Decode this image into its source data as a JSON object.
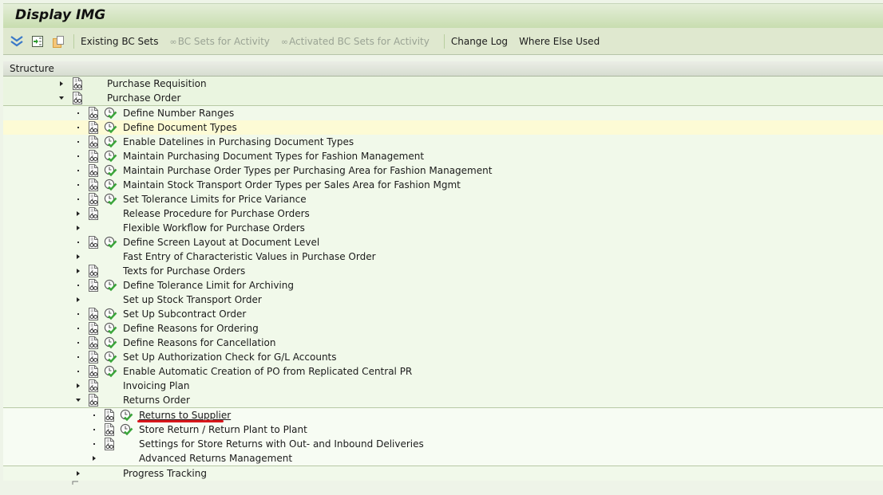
{
  "window": {
    "title": "Display IMG"
  },
  "toolbar": {
    "icons": [
      "expand-all-icon",
      "execute-icon",
      "clipboard-icon"
    ],
    "existing_bc_sets": "Existing BC Sets",
    "bc_sets_for_activity": "BC Sets for Activity",
    "activated_bc_sets_for_activity": "Activated BC Sets for Activity",
    "change_log": "Change Log",
    "where_else_used": "Where Else Used"
  },
  "structure": {
    "header": "Structure",
    "level1": [
      {
        "label": "Purchase Requisition",
        "expander": "collapsed",
        "doc_icon": true,
        "activity_icon": false
      },
      {
        "label": "Purchase Order",
        "expander": "expanded",
        "doc_icon": true,
        "activity_icon": false
      }
    ],
    "purchase_order_children": [
      {
        "label": "Define Number Ranges",
        "expander": "leaf",
        "doc_icon": true,
        "activity_icon": true
      },
      {
        "label": "Define Document Types",
        "expander": "leaf",
        "doc_icon": true,
        "activity_icon": true,
        "highlighted": true
      },
      {
        "label": "Enable Datelines in Purchasing Document Types",
        "expander": "leaf",
        "doc_icon": true,
        "activity_icon": true
      },
      {
        "label": "Maintain Purchasing Document Types for Fashion Management",
        "expander": "leaf",
        "doc_icon": true,
        "activity_icon": true
      },
      {
        "label": "Maintain Purchase Order Types per Purchasing Area for Fashion Management",
        "expander": "leaf",
        "doc_icon": true,
        "activity_icon": true
      },
      {
        "label": "Maintain Stock Transport Order Types per Sales Area for Fashion Mgmt",
        "expander": "leaf",
        "doc_icon": true,
        "activity_icon": true
      },
      {
        "label": "Set Tolerance Limits for Price Variance",
        "expander": "leaf",
        "doc_icon": true,
        "activity_icon": true
      },
      {
        "label": "Release Procedure for Purchase Orders",
        "expander": "collapsed",
        "doc_icon": true,
        "activity_icon": false
      },
      {
        "label": "Flexible Workflow for Purchase Orders",
        "expander": "collapsed",
        "doc_icon": false,
        "activity_icon": false
      },
      {
        "label": "Define Screen Layout at Document Level",
        "expander": "leaf",
        "doc_icon": true,
        "activity_icon": true
      },
      {
        "label": "Fast Entry of Characteristic Values in Purchase Order",
        "expander": "collapsed",
        "doc_icon": false,
        "activity_icon": false
      },
      {
        "label": "Texts for Purchase Orders",
        "expander": "collapsed",
        "doc_icon": true,
        "activity_icon": false
      },
      {
        "label": "Define Tolerance Limit for Archiving",
        "expander": "leaf",
        "doc_icon": true,
        "activity_icon": true
      },
      {
        "label": "Set up Stock Transport Order",
        "expander": "collapsed",
        "doc_icon": false,
        "activity_icon": false
      },
      {
        "label": "Set Up Subcontract Order",
        "expander": "leaf",
        "doc_icon": true,
        "activity_icon": true
      },
      {
        "label": "Define Reasons for Ordering",
        "expander": "leaf",
        "doc_icon": true,
        "activity_icon": true
      },
      {
        "label": "Define Reasons for Cancellation",
        "expander": "leaf",
        "doc_icon": true,
        "activity_icon": true
      },
      {
        "label": "Set Up Authorization Check for G/L Accounts",
        "expander": "leaf",
        "doc_icon": true,
        "activity_icon": true
      },
      {
        "label": "Enable Automatic Creation of PO from Replicated Central PR",
        "expander": "leaf",
        "doc_icon": true,
        "activity_icon": true
      },
      {
        "label": "Invoicing Plan",
        "expander": "collapsed",
        "doc_icon": true,
        "activity_icon": false
      },
      {
        "label": "Returns Order",
        "expander": "expanded",
        "doc_icon": true,
        "activity_icon": false
      }
    ],
    "returns_order_children": [
      {
        "label": "Returns to Supplier",
        "expander": "leaf",
        "doc_icon": true,
        "activity_icon": true,
        "annotated": true
      },
      {
        "label": "Store Return / Return Plant to Plant",
        "expander": "leaf",
        "doc_icon": true,
        "activity_icon": true
      },
      {
        "label": "Settings for Store Returns with Out- and Inbound Deliveries",
        "expander": "leaf",
        "doc_icon": true,
        "activity_icon": false
      },
      {
        "label": "Advanced Returns Management",
        "expander": "collapsed",
        "doc_icon": false,
        "activity_icon": false
      }
    ],
    "after_returns": [
      {
        "label": "Progress Tracking",
        "expander": "collapsed",
        "doc_icon": false,
        "activity_icon": false
      }
    ]
  },
  "colors": {
    "title_bar": "#c8ddb0",
    "toolbar": "#dfe8cf",
    "highlight_row": "#fdfbd5",
    "annotation_underline": "#d8181d",
    "activity_check": "#3aa53a"
  }
}
